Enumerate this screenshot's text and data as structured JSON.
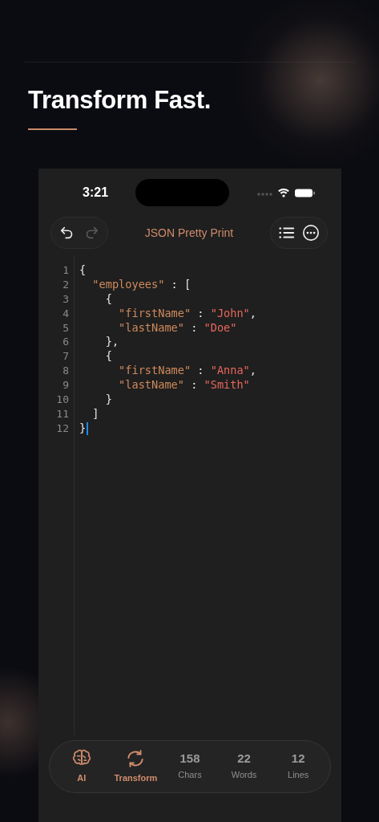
{
  "headline": "Transform Fast.",
  "status_bar": {
    "time": "3:21"
  },
  "toolbar": {
    "title": "JSON Pretty Print",
    "history": [
      {
        "kind": "undo",
        "disabled": false
      },
      {
        "kind": "redo",
        "disabled": true
      }
    ],
    "actions": [
      {
        "kind": "list"
      },
      {
        "kind": "more"
      }
    ]
  },
  "editor": {
    "lines": [
      {
        "number": "1",
        "cursor": false,
        "tokens": [
          {
            "kind": "punct",
            "text": "{"
          }
        ]
      },
      {
        "number": "2",
        "cursor": false,
        "tokens": [
          {
            "kind": "key",
            "text": "  \"employees\""
          },
          {
            "kind": "punct",
            "text": " : ["
          }
        ]
      },
      {
        "number": "3",
        "cursor": false,
        "tokens": [
          {
            "kind": "punct",
            "text": "    {"
          }
        ]
      },
      {
        "number": "4",
        "cursor": false,
        "tokens": [
          {
            "kind": "key",
            "text": "      \"firstName\""
          },
          {
            "kind": "punct",
            "text": " : "
          },
          {
            "kind": "string",
            "text": "\"John\""
          },
          {
            "kind": "punct",
            "text": ","
          }
        ]
      },
      {
        "number": "5",
        "cursor": false,
        "tokens": [
          {
            "kind": "key",
            "text": "      \"lastName\""
          },
          {
            "kind": "punct",
            "text": " : "
          },
          {
            "kind": "string",
            "text": "\"Doe\""
          }
        ]
      },
      {
        "number": "6",
        "cursor": false,
        "tokens": [
          {
            "kind": "punct",
            "text": "    },"
          }
        ]
      },
      {
        "number": "7",
        "cursor": false,
        "tokens": [
          {
            "kind": "punct",
            "text": "    {"
          }
        ]
      },
      {
        "number": "8",
        "cursor": false,
        "tokens": [
          {
            "kind": "key",
            "text": "      \"firstName\""
          },
          {
            "kind": "punct",
            "text": " : "
          },
          {
            "kind": "string",
            "text": "\"Anna\""
          },
          {
            "kind": "punct",
            "text": ","
          }
        ]
      },
      {
        "number": "9",
        "cursor": false,
        "tokens": [
          {
            "kind": "key",
            "text": "      \"lastName\""
          },
          {
            "kind": "punct",
            "text": " : "
          },
          {
            "kind": "string",
            "text": "\"Smith\""
          }
        ]
      },
      {
        "number": "10",
        "cursor": false,
        "tokens": [
          {
            "kind": "punct",
            "text": "    }"
          }
        ]
      },
      {
        "number": "11",
        "cursor": false,
        "tokens": [
          {
            "kind": "punct",
            "text": "  ]"
          }
        ]
      },
      {
        "number": "12",
        "cursor": true,
        "tokens": [
          {
            "kind": "punct",
            "text": "}"
          }
        ]
      }
    ]
  },
  "bottom_bar": [
    {
      "kind": "action",
      "label": "AI"
    },
    {
      "kind": "action",
      "label": "Transform"
    },
    {
      "kind": "stat",
      "value": "158",
      "label": "Chars"
    },
    {
      "kind": "stat",
      "value": "22",
      "label": "Words"
    },
    {
      "kind": "stat",
      "value": "12",
      "label": "Lines"
    }
  ]
}
